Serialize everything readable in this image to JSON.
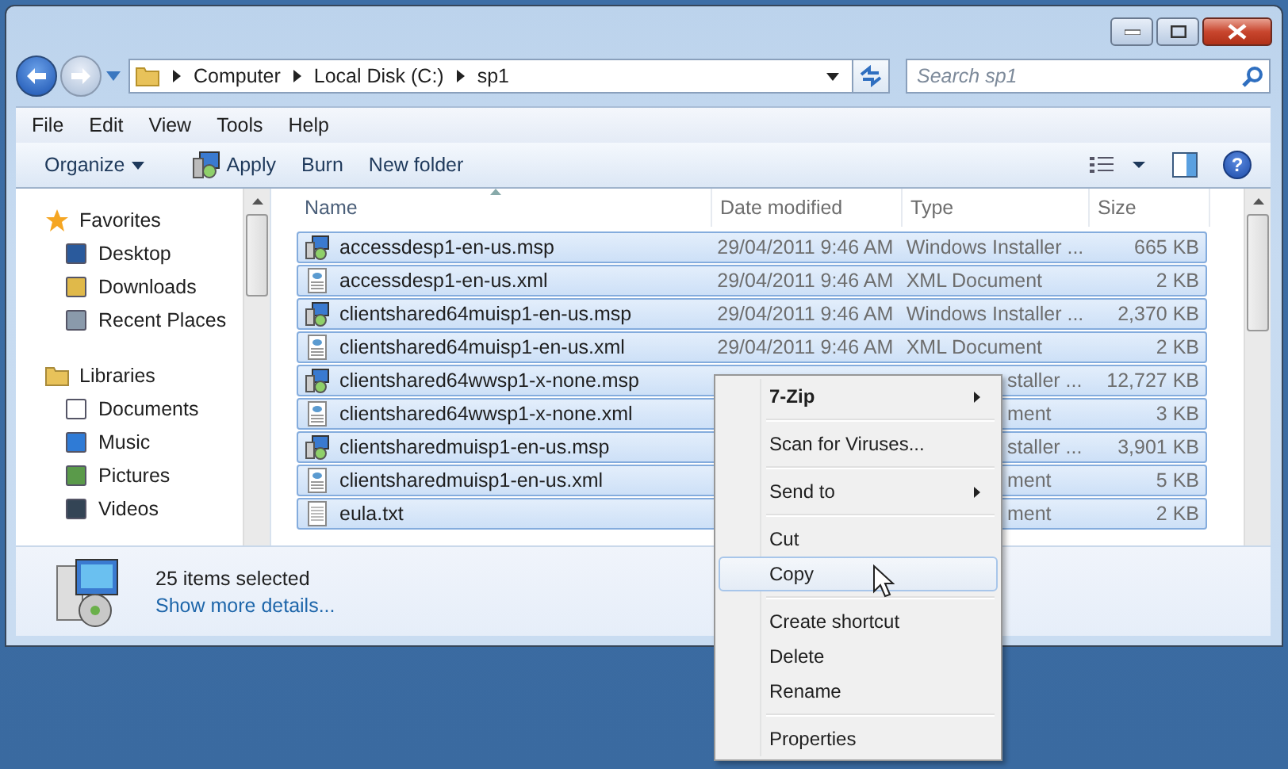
{
  "address": {
    "crumbs": [
      "Computer",
      "Local Disk (C:)",
      "sp1"
    ]
  },
  "search": {
    "placeholder": "Search sp1"
  },
  "menu_bar": [
    "File",
    "Edit",
    "View",
    "Tools",
    "Help"
  ],
  "command_bar": [
    {
      "label": "Organize",
      "kind": "dropdown"
    },
    {
      "label": "Apply",
      "kind": "installer"
    },
    {
      "label": "Burn",
      "kind": "plain"
    },
    {
      "label": "New folder",
      "kind": "plain"
    }
  ],
  "help_button": "?",
  "nav": [
    {
      "label": "Favorites",
      "children": [
        {
          "label": "Desktop"
        },
        {
          "label": "Downloads"
        },
        {
          "label": "Recent Places"
        }
      ]
    },
    {
      "label": "Libraries",
      "children": [
        {
          "label": "Documents"
        },
        {
          "label": "Music"
        },
        {
          "label": "Pictures"
        },
        {
          "label": "Videos"
        }
      ]
    }
  ],
  "table": {
    "columns": [
      "Name",
      "Date modified",
      "Type",
      "Size"
    ],
    "rows": [
      {
        "name": "accessdesp1-en-us.msp",
        "kind": "installer",
        "date": "29/04/2011 9:46 AM",
        "type": "Windows Installer ...",
        "size": "665 KB",
        "selected": true
      },
      {
        "name": "accessdesp1-en-us.xml",
        "kind": "xml",
        "date": "29/04/2011 9:46 AM",
        "type": "XML Document",
        "size": "2 KB",
        "selected": true
      },
      {
        "name": "clientshared64muisp1-en-us.msp",
        "kind": "installer",
        "date": "29/04/2011 9:46 AM",
        "type": "Windows Installer ...",
        "size": "2,370 KB",
        "selected": true
      },
      {
        "name": "clientshared64muisp1-en-us.xml",
        "kind": "xml",
        "date": "29/04/2011 9:46 AM",
        "type": "XML Document",
        "size": "2 KB",
        "selected": true
      },
      {
        "name": "clientshared64wwsp1-x-none.msp",
        "kind": "installer",
        "type": "staller ...",
        "size": "12,727 KB",
        "selected": true
      },
      {
        "name": "clientshared64wwsp1-x-none.xml",
        "kind": "xml",
        "type": "ment",
        "size": "3 KB",
        "selected": true
      },
      {
        "name": "clientsharedmuisp1-en-us.msp",
        "kind": "installer",
        "type": "staller ...",
        "size": "3,901 KB",
        "selected": true
      },
      {
        "name": "clientsharedmuisp1-en-us.xml",
        "kind": "xml",
        "type": "ment",
        "size": "5 KB",
        "selected": true
      },
      {
        "name": "eula.txt",
        "kind": "text",
        "type": "ment",
        "size": "2 KB",
        "selected": true
      }
    ]
  },
  "details": {
    "summary": "25 items selected",
    "link": "Show more details..."
  },
  "context_menu": [
    {
      "kind": "item",
      "label": "7-Zip",
      "default": true,
      "submenu": true,
      "selected": false
    },
    {
      "kind": "separator"
    },
    {
      "kind": "item",
      "label": "Scan for Viruses...",
      "default": false,
      "submenu": false,
      "selected": false
    },
    {
      "kind": "separator"
    },
    {
      "kind": "item",
      "label": "Send to",
      "default": false,
      "submenu": true,
      "selected": false
    },
    {
      "kind": "separator"
    },
    {
      "kind": "item",
      "label": "Cut",
      "default": false,
      "submenu": false,
      "selected": false
    },
    {
      "kind": "item",
      "label": "Copy",
      "default": false,
      "submenu": false,
      "selected": true
    },
    {
      "kind": "separator"
    },
    {
      "kind": "item",
      "label": "Create shortcut",
      "default": false,
      "submenu": false,
      "selected": false
    },
    {
      "kind": "item",
      "label": "Delete",
      "default": false,
      "submenu": false,
      "selected": false
    },
    {
      "kind": "item",
      "label": "Rename",
      "default": false,
      "submenu": false,
      "selected": false
    },
    {
      "kind": "separator"
    },
    {
      "kind": "item",
      "label": "Properties",
      "default": false,
      "submenu": false,
      "selected": false
    }
  ]
}
